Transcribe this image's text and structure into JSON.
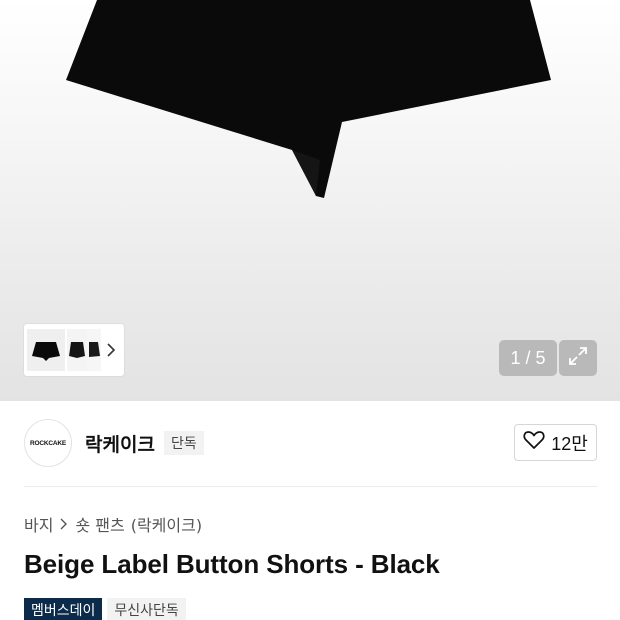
{
  "gallery": {
    "counter": "1 / 5",
    "current_index": 1,
    "total_images": 5,
    "thumbnail_count": 3
  },
  "brand": {
    "logo_text": "ROCKCAKE",
    "name": "락케이크",
    "exclusive_label": "단독"
  },
  "likes": {
    "count": "12만"
  },
  "breadcrumb": {
    "items": [
      "바지",
      "숏 팬츠",
      "(락케이크)"
    ]
  },
  "product": {
    "title": "Beige Label Button Shorts - Black"
  },
  "tags": {
    "member_day": "멤버스데이",
    "musinsa_exclusive": "무신사단독"
  },
  "colors": {
    "member_tag_bg": "#0c2a4a",
    "counter_bg": "#aaaaaa",
    "product_color": "#0a0a0a"
  },
  "icons": [
    "chevron-right-icon",
    "expand-icon",
    "heart-icon"
  ]
}
